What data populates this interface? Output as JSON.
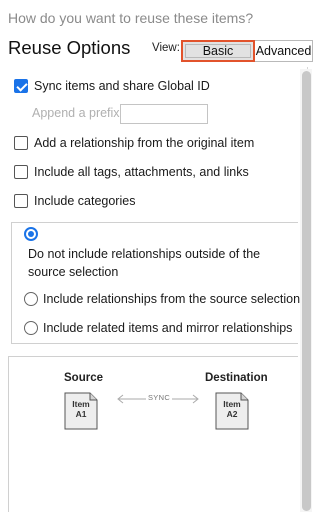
{
  "header": {
    "question": "How do you want to reuse these items?",
    "title": "Reuse Options",
    "view_label": "View:",
    "view_options": [
      "Basic",
      "Advanced"
    ],
    "view_selected": "Basic"
  },
  "options": {
    "sync": {
      "label": "Sync items and share Global ID",
      "checked": true
    },
    "prefix": {
      "label": "Append a prefix",
      "value": "",
      "enabled": false
    },
    "relationship": {
      "label": "Add a relationship from the original item",
      "checked": false
    },
    "tags": {
      "label": "Include all tags, attachments, and links",
      "checked": false
    },
    "categories": {
      "label": "Include categories",
      "checked": false
    }
  },
  "relationships": {
    "options": [
      "Do not include relationships outside of the source selection",
      "Include relationships from the source selection",
      "Include related items and mirror relationships"
    ],
    "selected": 0
  },
  "diagram": {
    "source_label": "Source",
    "destination_label": "Destination",
    "sync_label": "SYNC",
    "source_item": {
      "line1": "Item",
      "line2": "A1"
    },
    "destination_item": {
      "line1": "Item",
      "line2": "A2"
    }
  },
  "colors": {
    "accent": "#1a73e8",
    "highlight": "#e2532c"
  }
}
